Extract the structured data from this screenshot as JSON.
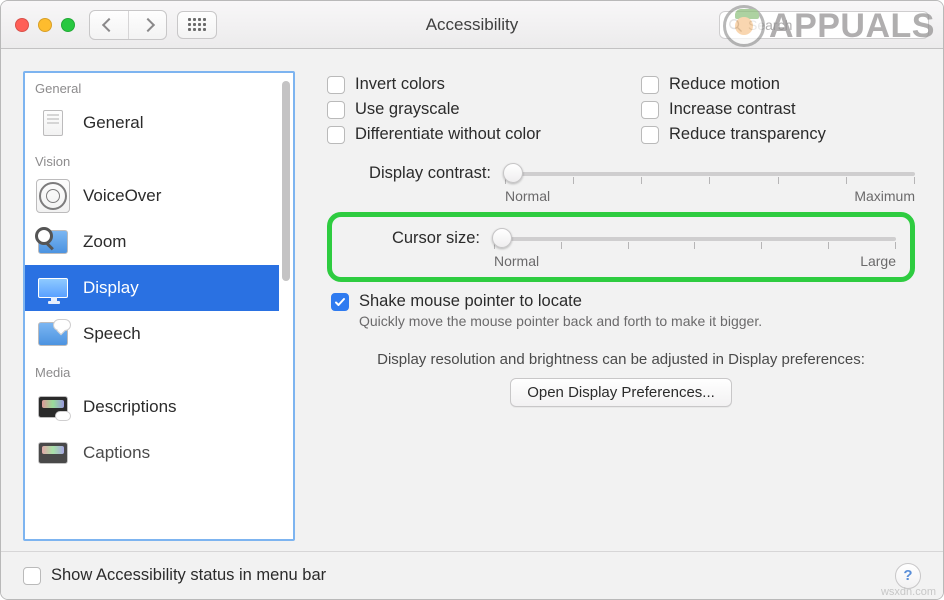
{
  "window": {
    "title": "Accessibility"
  },
  "search": {
    "placeholder": "Search"
  },
  "watermark": {
    "text_a": "A",
    "text_rest": "PPUALS"
  },
  "sidebar": {
    "sections": {
      "general": "General",
      "vision": "Vision",
      "media": "Media"
    },
    "items": {
      "general": "General",
      "voiceover": "VoiceOver",
      "zoom": "Zoom",
      "display": "Display",
      "speech": "Speech",
      "descriptions": "Descriptions",
      "captions": "Captions"
    }
  },
  "options": {
    "invert_colors": "Invert colors",
    "use_grayscale": "Use grayscale",
    "diff_without_color": "Differentiate without color",
    "reduce_motion": "Reduce motion",
    "increase_contrast": "Increase contrast",
    "reduce_transparency": "Reduce transparency"
  },
  "sliders": {
    "contrast": {
      "label": "Display contrast:",
      "min_label": "Normal",
      "max_label": "Maximum"
    },
    "cursor": {
      "label": "Cursor size:",
      "min_label": "Normal",
      "max_label": "Large"
    }
  },
  "shake": {
    "label": "Shake mouse pointer to locate",
    "hint": "Quickly move the mouse pointer back and forth to make it bigger."
  },
  "display_note": "Display resolution and brightness can be adjusted in Display preferences:",
  "open_display_btn": "Open Display Preferences...",
  "footer": {
    "show_status": "Show Accessibility status in menu bar"
  },
  "help": "?",
  "source_note": "wsxdn.com"
}
